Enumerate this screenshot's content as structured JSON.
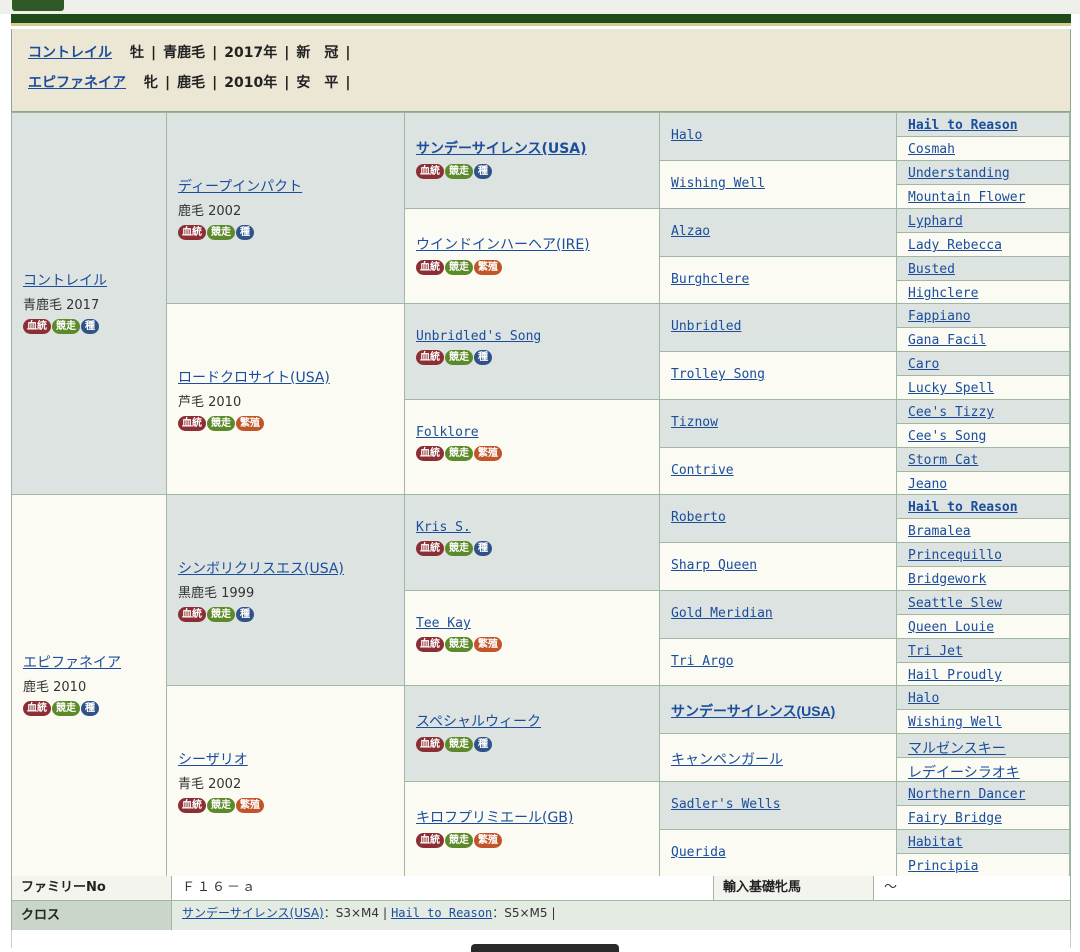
{
  "header": {
    "rows": [
      {
        "name": "コントレイル",
        "sex": "牡",
        "color": "青鹿毛",
        "year": "2017年",
        "status": "新　冠"
      },
      {
        "name": "エピファネイア",
        "sex": "牝",
        "color": "鹿毛",
        "year": "2010年",
        "status": "安　平"
      }
    ]
  },
  "badges": {
    "ketto": "血統",
    "kyoso": "競走",
    "shu": "種",
    "hanshoku": "繁殖"
  },
  "gen1": [
    {
      "name": "コントレイル",
      "sub": "青鹿毛 2017"
    },
    {
      "name": "エピファネイア",
      "sub": "鹿毛 2010"
    }
  ],
  "gen2": [
    {
      "name": "ディープインパクト",
      "sub": "鹿毛 2002"
    },
    {
      "name": "ロードクロサイト(USA)",
      "sub": "芦毛 2010"
    },
    {
      "name": "シンボリクリスエス(USA)",
      "sub": "黒鹿毛 1999"
    },
    {
      "name": "シーザリオ",
      "sub": "青毛 2002"
    }
  ],
  "gen3": [
    {
      "name": "サンデーサイレンス(USA)"
    },
    {
      "name": "ウインドインハーヘア(IRE)"
    },
    {
      "name": "Unbridled's Song"
    },
    {
      "name": "Folklore"
    },
    {
      "name": "Kris S."
    },
    {
      "name": "Tee Kay"
    },
    {
      "name": "スペシャルウィーク"
    },
    {
      "name": "キロフプリミエール(GB)"
    }
  ],
  "gen4": [
    "Halo",
    "Wishing Well",
    "Alzao",
    "Burghclere",
    "Unbridled",
    "Trolley Song",
    "Tiznow",
    "Contrive",
    "Roberto",
    "Sharp Queen",
    "Gold Meridian",
    "Tri Argo",
    "サンデーサイレンス(USA)",
    "キャンペンガール",
    "Sadler's Wells",
    "Querida"
  ],
  "gen5": [
    "Hail to Reason",
    "Cosmah",
    "Understanding",
    "Mountain Flower",
    "Lyphard",
    "Lady Rebecca",
    "Busted",
    "Highclere",
    "Fappiano",
    "Gana Facil",
    "Caro",
    "Lucky Spell",
    "Cee's Tizzy",
    "Cee's Song",
    "Storm Cat",
    "Jeano",
    "Hail to Reason",
    "Bramalea",
    "Princequillo",
    "Bridgework",
    "Seattle Slew",
    "Queen Louie",
    "Tri Jet",
    "Hail Proudly",
    "Halo",
    "Wishing Well",
    "マルゼンスキー",
    "レデイーシラオキ",
    "Northern Dancer",
    "Fairy Bridge",
    "Habitat",
    "Principia"
  ],
  "info": {
    "family_label": "ファミリーNo",
    "family_value": "Ｆ１６－ａ",
    "import_label": "輸入基礎牝馬",
    "import_value": "～",
    "cross_label": "クロス",
    "cross1_name": "サンデーサイレンス(USA)",
    "cross1_val": "：S3×M4",
    "cross2_name": "Hail to Reason",
    "cross2_val": "：S5×M5"
  }
}
